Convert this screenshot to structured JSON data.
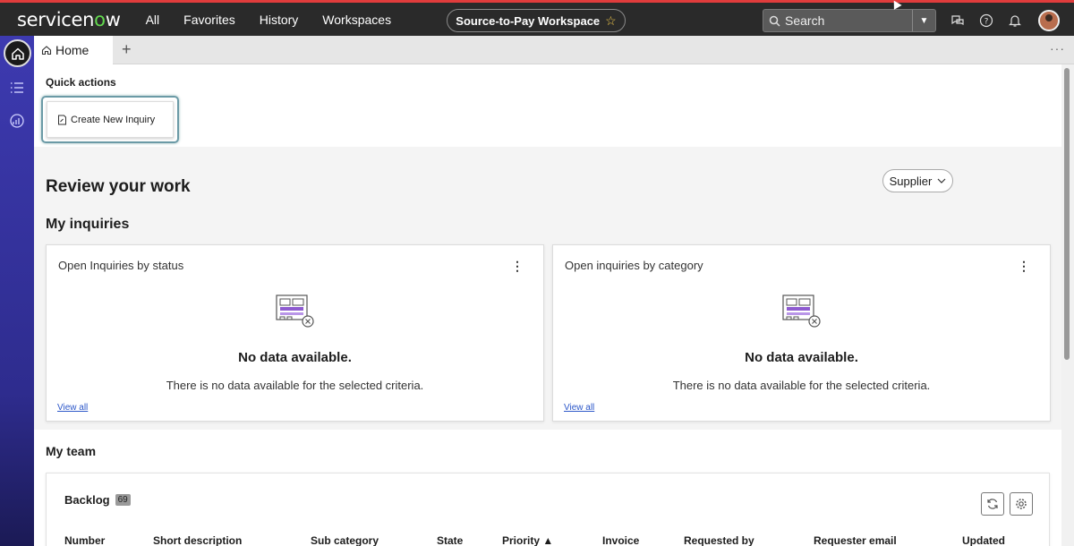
{
  "topbar": {
    "logo": {
      "pre": "servicen",
      "o": "o",
      "post": "w"
    },
    "nav": [
      "All",
      "Favorites",
      "History",
      "Workspaces"
    ],
    "workspace": "Source-to-Pay Workspace",
    "search_placeholder": "Search",
    "accent": "#62d84e"
  },
  "tabs": {
    "home_label": "Home",
    "add_label": "+",
    "more_label": "···"
  },
  "quick_actions": {
    "title": "Quick actions",
    "create_label": "Create New Inquiry"
  },
  "review": {
    "title": "Review your work",
    "filter_label": "Supplier"
  },
  "inquiries": {
    "title": "My inquiries",
    "cards": [
      {
        "title": "Open Inquiries by status",
        "nodata_title": "No data available.",
        "nodata_sub": "There is no data available for the selected criteria.",
        "view_all": "View all"
      },
      {
        "title": "Open inquiries by category",
        "nodata_title": "No data available.",
        "nodata_sub": "There is no data available for the selected criteria.",
        "view_all": "View all"
      }
    ]
  },
  "team": {
    "title": "My team",
    "backlog_label": "Backlog",
    "backlog_count": "69",
    "columns": [
      "Number",
      "Short description",
      "Sub category",
      "State",
      "Priority ▲",
      "Invoice",
      "Requested by",
      "Requester email",
      "Updated"
    ]
  }
}
